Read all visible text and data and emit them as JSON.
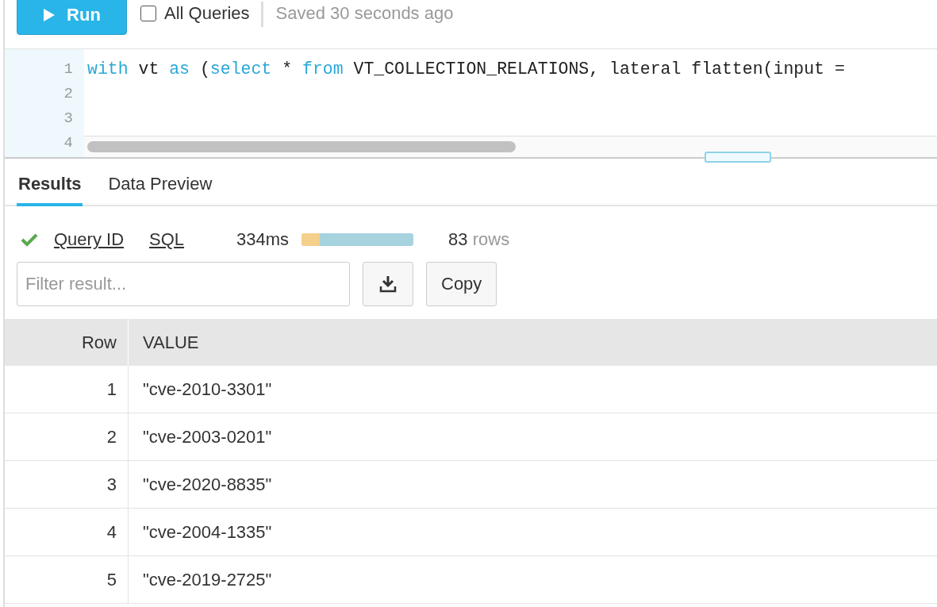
{
  "toolbar": {
    "run_button": "Run",
    "all_queries": {
      "label": "All Queries",
      "checked": false
    },
    "save_status": "Saved 30 seconds ago"
  },
  "editor": {
    "lines": [
      {
        "number": "1",
        "tokens": [
          {
            "kind": "keyword",
            "text": "with"
          },
          {
            "kind": "plain",
            "text": " vt "
          },
          {
            "kind": "keyword",
            "text": "as"
          },
          {
            "kind": "plain",
            "text": " ("
          },
          {
            "kind": "keyword",
            "text": "select"
          },
          {
            "kind": "plain",
            "text": " * "
          },
          {
            "kind": "keyword",
            "text": "from"
          },
          {
            "kind": "plain",
            "text": " VT_COLLECTION_RELATIONS, lateral flatten(input ="
          }
        ]
      },
      {
        "number": "2"
      },
      {
        "number": "3"
      },
      {
        "number": "4"
      }
    ]
  },
  "tabs": [
    {
      "label": "Results",
      "selected": true
    },
    {
      "label": "Data Preview",
      "selected": false
    }
  ],
  "status": {
    "success": true,
    "links": [
      "Query ID",
      "SQL"
    ],
    "duration": "334ms",
    "timing_bar": [
      {
        "level": 0.16,
        "color": "#f5cf8c"
      },
      {
        "level": 0.84,
        "color": "#a6d3de"
      }
    ],
    "row_count": "83",
    "row_unit": "rows"
  },
  "filter": {
    "placeholder": "Filter result..."
  },
  "copy_button": "Copy",
  "table": {
    "columns": [
      "Row",
      "VALUE"
    ],
    "rows": [
      [
        "1",
        "\"cve-2010-3301\""
      ],
      [
        "2",
        "\"cve-2003-0201\""
      ],
      [
        "3",
        "\"cve-2020-8835\""
      ],
      [
        "4",
        "\"cve-2004-1335\""
      ],
      [
        "5",
        "\"cve-2019-2725\""
      ]
    ]
  }
}
